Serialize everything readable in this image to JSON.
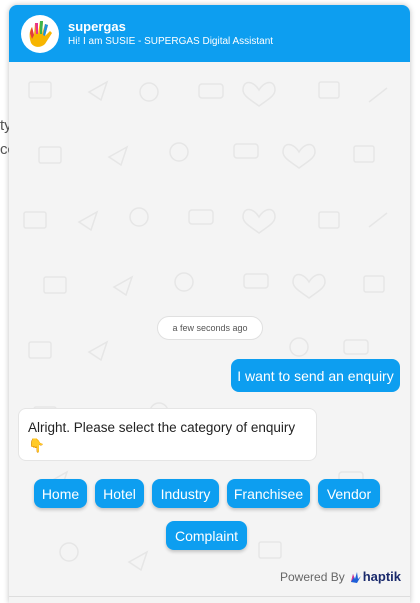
{
  "background": {
    "lines": [
      "ty",
      "cc"
    ]
  },
  "header": {
    "title": "supergas",
    "subtitle": "Hi! I am SUSIE - SUPERGAS Digital Assistant",
    "color": "#0d9ef0"
  },
  "chat": {
    "timestamp": "a few seconds ago",
    "user_message": "I want to send an enquiry",
    "bot_message": "Alright. Please select the category of enquiry",
    "bot_emoji": "👇"
  },
  "quick_replies": [
    {
      "label": "Home"
    },
    {
      "label": "Hotel"
    },
    {
      "label": "Industry"
    },
    {
      "label": "Franchisee"
    },
    {
      "label": "Vendor"
    },
    {
      "label": "Complaint"
    }
  ],
  "footer": {
    "powered_by": "Powered By",
    "brand": "haptik"
  }
}
